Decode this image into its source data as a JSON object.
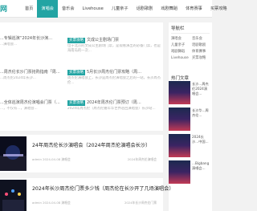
{
  "header": {
    "logo": "网",
    "nav": [
      "首页",
      "演唱会",
      "音乐会",
      "Livehouse",
      "儿童亲子",
      "话剧歌剧",
      "戏剧舞蹈",
      "体育赛事",
      "买票攻略"
    ]
  },
  "featured": {
    "left": [
      {
        "title": "...专辑巡演“2024年长沙演…",
        "desc": "...演唱会..."
      },
      {
        "title": "...周杰伦长沙门票抢购指南「周…",
        "desc": "...周杰伦2024年长沙..."
      },
      {
        "title": "...全体巡演周杰伦演唱会门票（…",
        "desc": "...，不仅有...，演唱会..."
      }
    ],
    "right": [
      {
        "tag": "买票攻略",
        "title": "文成公主剧场门票",
        "desc": "位于北京的文成公主剧场门票，是观看演出的必备门票，也是海南岛的一次..."
      },
      {
        "tag": "买票攻略",
        "title": "5月长沙周杰伦门票攻略（周…",
        "desc": "周杰伦演唱会上，长沙是周杰伦演唱会之后的一站，长沙周杰伦..."
      },
      {
        "tag": "买票攻略",
        "title": "2024年周杰伦门票预订（周…",
        "desc": "2024年周杰伦（周杰伦嘉年华世界巡回演唱会）长沙站..."
      }
    ]
  },
  "sidebar": {
    "tag_title": "导航栏",
    "tags": [
      "演唱会",
      "音乐会",
      "儿童亲子",
      "话剧歌剧",
      "戏剧舞蹈",
      "体育赛事",
      "Livehouse",
      "买票攻略"
    ],
    "hot_title": "热门文章",
    "hot": [
      {
        "text": "长沙...周杰伦2024演唱会..."
      },
      {
        "text": "长沙华...周杰伦..."
      },
      {
        "text": "2024长沙...中国..."
      },
      {
        "text": "...Bigbang演唱会..."
      },
      {
        "text": "2024长沙周杰伦演唱会..."
      }
    ]
  },
  "articles": [
    {
      "title": "24年周杰伦长沙演唱会（2024年周杰伦演唱会长沙）",
      "meta": "admin   2024-04-08   演唱会",
      "right": "2024年周杰伦演唱会"
    },
    {
      "title": "2024年长沙周杰伦门票多少钱（周杰伦在长沙开了几场演唱会）",
      "meta": "admin   2024-04-08   演唱会",
      "right": "2024年长沙周杰伦门票"
    }
  ]
}
